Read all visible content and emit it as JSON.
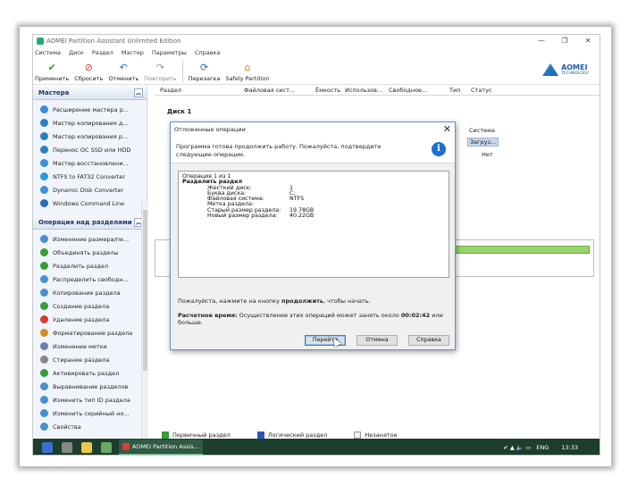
{
  "window": {
    "title": "AOMEI Partition Assistant Unlimited Edition",
    "controls": [
      "—",
      "❐",
      "✕"
    ]
  },
  "menu": [
    "Система",
    "Диск",
    "Раздел",
    "Мастер",
    "Параметры",
    "Справка"
  ],
  "toolbar": {
    "buttons": [
      {
        "label": "Применить",
        "icon": "check-icon"
      },
      {
        "label": "Сбросить",
        "icon": "reset-icon"
      },
      {
        "label": "Отменить",
        "icon": "undo-icon"
      },
      {
        "label": "Повторить",
        "icon": "redo-icon"
      },
      {
        "label": "Перезагка",
        "icon": "reload-icon"
      },
      {
        "label": "Safely Partition",
        "icon": "safely-partition-icon"
      }
    ],
    "logo_line1": "AOMEI",
    "logo_line2": "TECHNOLOGY"
  },
  "sidebar": {
    "wizards_title": "Мастера",
    "wizards": [
      "Расширение мастера р...",
      "Мастер копирования д...",
      "Мастер копирования р...",
      "Перенос ОС SSD или HDD",
      "Мастер восстановлени...",
      "NTFS to FAT32 Converter",
      "Dynamic Disk Converter",
      "Windows Command Line"
    ],
    "ops_title": "Операция над разделами",
    "ops": [
      "Изменение размера/пе...",
      "Объединять разделы",
      "Разделить раздел",
      "Распределить свободн...",
      "Копирование раздела",
      "Создание раздела",
      "Удаление раздела",
      "Форматирование раздела",
      "Изменение метки",
      "Стирание раздела",
      "Активировать раздел",
      "Выравнивание разделов",
      "Изменить тип ID раздела",
      "Изменить серийный но...",
      "Свойства"
    ]
  },
  "columns": [
    "Раздел",
    "Файловая сист...",
    "Ёмкость",
    "Использов...",
    "Свободное...",
    "Тип",
    "Статус"
  ],
  "main": {
    "disk_label": "Диск 1",
    "status_system": "Система",
    "status_boot": "Загруз...",
    "status_no": "Нет"
  },
  "legend": [
    "Первичный раздел",
    "Логический раздел",
    "Незанятое"
  ],
  "dialog": {
    "title": "Отложенные операции",
    "intro": "Программа готова продолжить работу. Пожалуйста, подтвердите следующие операции.",
    "op_counter": "Операция 1 из 1",
    "op_name": "Разделить раздел",
    "fields": [
      {
        "k": "Жесткий диск:",
        "v": "1"
      },
      {
        "k": "Буква диска:",
        "v": "C:"
      },
      {
        "k": "Файловая система:",
        "v": "NTFS"
      },
      {
        "k": "Метка раздела:",
        "v": ""
      },
      {
        "k": "Старый размер раздела:",
        "v": "19.78GB"
      },
      {
        "k": "Новый размер раздела:",
        "v": "40.22GB"
      }
    ],
    "msg_pre": "Пожалуйста, нажмите на кнопку ",
    "msg_bold": "продолжить",
    "msg_post": ", чтобы начать.",
    "time_label": "Расчетное время:",
    "time_pre": " Осуществление этих операций может занять около ",
    "time_value": "00:02:42",
    "time_post": " или больше.",
    "buttons": [
      "Перейти",
      "Отмена",
      "Справка"
    ]
  },
  "taskbar": {
    "app": "AOMEI Partition Assis...",
    "lang": "ENG",
    "time": "13:33"
  },
  "colors": {
    "accent": "#1d6fd2",
    "disk_bar": "#9ad36e",
    "taskbar": "#1d3e2c"
  }
}
